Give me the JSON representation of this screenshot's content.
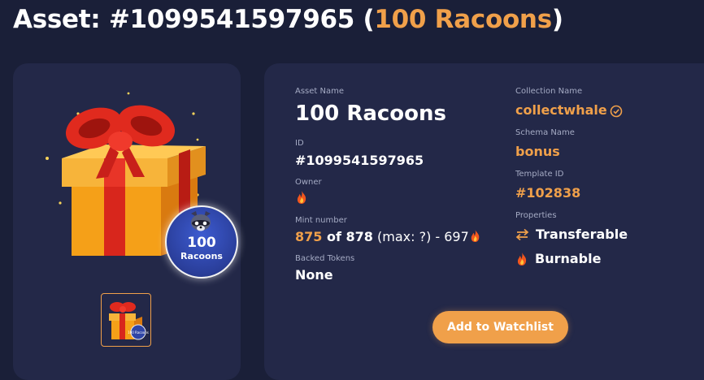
{
  "header": {
    "title_prefix": "Asset: #1099541597965 (",
    "title_accent": "100 Racoons",
    "title_suffix": ")"
  },
  "preview": {
    "badge_number": "100",
    "badge_text": "Racoons",
    "thumb_badge": "100 Racoons"
  },
  "details": {
    "asset_name_label": "Asset Name",
    "asset_name": "100 Racoons",
    "id_label": "ID",
    "id": "#1099541597965",
    "owner_label": "Owner",
    "owner_icon": "fire-icon",
    "mint_label": "Mint number",
    "mint_current": "875",
    "mint_of": " of 878",
    "mint_rest": " (max: ?) - 697",
    "backed_label": "Backed Tokens",
    "backed": "None",
    "collection_label": "Collection Name",
    "collection": "collectwhale",
    "schema_label": "Schema Name",
    "schema": "bonus",
    "template_label": "Template ID",
    "template": "#102838",
    "properties_label": "Properties",
    "properties": [
      {
        "icon": "transfer-arrows-icon",
        "label": "Transferable"
      },
      {
        "icon": "fire-icon",
        "label": "Burnable"
      }
    ]
  },
  "actions": {
    "watchlist_label": "Add to Watchlist"
  },
  "colors": {
    "background": "#1a1f38",
    "card": "#232848",
    "accent": "#f0a04a",
    "muted": "#a5abc4"
  }
}
